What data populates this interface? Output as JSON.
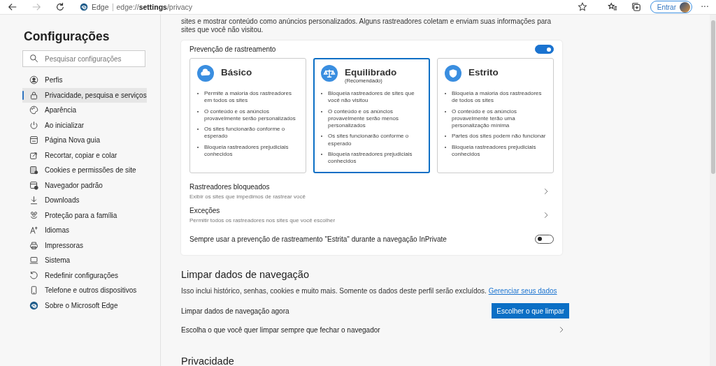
{
  "toolbar": {
    "site_label": "Edge",
    "address": "edge://**settings**/privacy",
    "signin_button": "Entrar",
    "more_button": "···"
  },
  "sidebar": {
    "title": "Configurações",
    "search": {
      "placeholder": "Pesquisar configurações"
    },
    "items": [
      {
        "label": "Perfis",
        "selected": false
      },
      {
        "label": "Privacidade, pesquisa e serviços",
        "selected": true
      },
      {
        "label": "Aparência",
        "selected": false
      },
      {
        "label": "Ao inicializar",
        "selected": false
      },
      {
        "label": "Página Nova guia",
        "selected": false
      },
      {
        "label": "Recortar, copiar e colar",
        "selected": false
      },
      {
        "label": "Cookies e permissões de site",
        "selected": false
      },
      {
        "label": "Navegador padrão",
        "selected": false
      },
      {
        "label": "Downloads",
        "selected": false
      },
      {
        "label": "Proteção para a família",
        "selected": false
      },
      {
        "label": "Idiomas",
        "selected": false
      },
      {
        "label": "Impressoras",
        "selected": false
      },
      {
        "label": "Sistema",
        "selected": false
      },
      {
        "label": "Redefinir configurações",
        "selected": false
      },
      {
        "label": "Telefone e outros dispositivos",
        "selected": false
      },
      {
        "label": "Sobre o Microsoft Edge",
        "selected": false
      }
    ]
  },
  "intro": "sites e mostrar conteúdo como anúncios personalizados. Alguns rastreadores coletam e enviam suas informações para sites que você não visitou.",
  "tracking": {
    "title": "Prevenção de rastreamento",
    "on": true,
    "levels": [
      {
        "name": "Básico",
        "selected": false,
        "bullets": [
          "Permite a maioria dos rastreadores em todos os sites",
          "O conteúdo e os anúncios provavelmente serão personalizados",
          "Os sites funcionarão conforme o esperado",
          "Bloqueia rastreadores prejudiciais conhecidos"
        ]
      },
      {
        "name": "Equilibrado",
        "note": "(Recomendado)",
        "selected": true,
        "bullets": [
          "Bloqueia rastreadores de sites que você não visitou",
          "O conteúdo e os anúncios provavelmente serão menos personalizados",
          "Os sites funcionarão conforme o esperado",
          "Bloqueia rastreadores prejudiciais conhecidos"
        ]
      },
      {
        "name": "Estrito",
        "selected": false,
        "bullets": [
          "Bloqueia a maioria dos rastreadores de todos os sites",
          "O conteúdo e os anúncios provavelmente terão uma personalização mínima",
          "Partes dos sites podem não funcionar",
          "Bloqueia rastreadores prejudiciais conhecidos"
        ]
      }
    ],
    "rows": [
      {
        "kind": "link",
        "title": "Rastreadores bloqueados",
        "subtitle": "Exibir os sites que impedimos de rastrear você"
      },
      {
        "kind": "link",
        "title": "Exceções",
        "subtitle": "Permitir todos os rastreadores nos sites que você escolher"
      },
      {
        "kind": "toggle",
        "title": "Sempre usar a prevenção de rastreamento \"Estrita\" durante a navegação InPrivate",
        "on": false
      }
    ]
  },
  "clear_data": {
    "title": "Limpar dados de navegação",
    "description": "Isso inclui histórico, senhas, cookies e muito mais. Somente os dados deste perfil serão excluídos.",
    "link": "Gerenciar seus dados",
    "rows": [
      {
        "kind": "button",
        "title": "Limpar dados de navegação agora",
        "button": "Escolher o que limpar"
      },
      {
        "kind": "link",
        "title": "Escolha o que você quer limpar sempre que fechar o navegador"
      }
    ]
  },
  "next_section": {
    "title": "Privacidade"
  }
}
